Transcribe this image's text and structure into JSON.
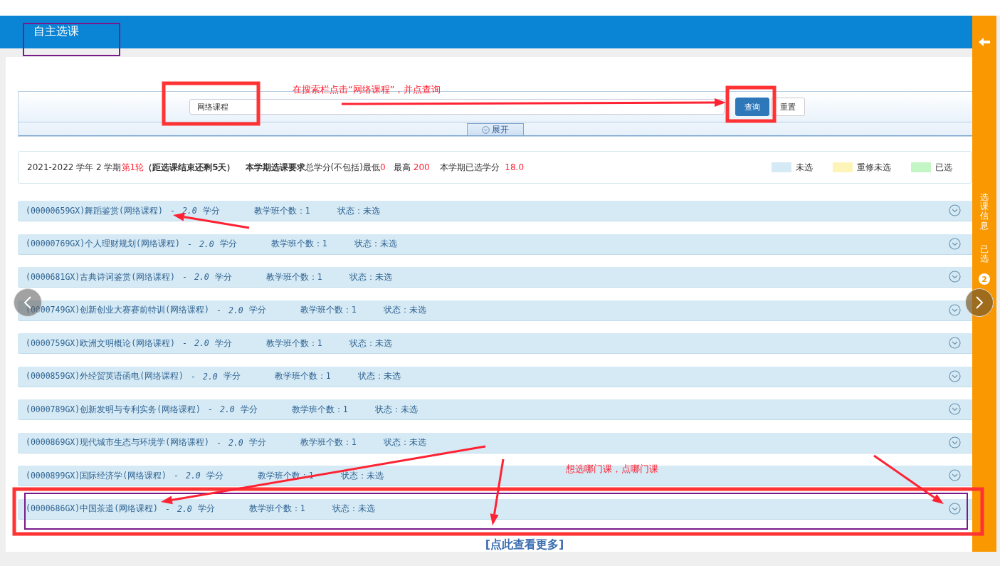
{
  "header": {
    "title": "自主选课"
  },
  "search": {
    "value": "网络课程",
    "buttons": [
      {
        "label": "查询",
        "kind": "primary"
      },
      {
        "label": "重置",
        "kind": "plain"
      }
    ],
    "expand": "展开"
  },
  "info": {
    "term": "2021-2022 学年 2 学期",
    "round": "第1轮",
    "remaining": "（距选课结束还剩5天）",
    "requirement_label": "本学期选课要求",
    "requirement_text": "总学分(不包括)最低",
    "min": "0",
    "max_label": "最高",
    "max": "200",
    "selected_label": "本学期已选学分",
    "selected": "18.0"
  },
  "legend": [
    {
      "label": "未选",
      "color": "#d6eaf5"
    },
    {
      "label": "重修未选",
      "color": "#fdf5b8"
    },
    {
      "label": "已选",
      "color": "#c4f5c4"
    }
  ],
  "courses": [
    {
      "title": "(00000659GX)舞蹈鉴赏(网络课程)",
      "dash": "-",
      "credit": "2.0",
      "unit": "学分",
      "classes": "教学班个数：1",
      "status": "状态：未选",
      "kind": "unselected"
    },
    {
      "title": "(00000769GX)个人理财规划(网络课程)",
      "dash": "-",
      "credit": "2.0",
      "unit": "学分",
      "classes": "教学班个数：1",
      "status": "状态：未选",
      "kind": "unselected"
    },
    {
      "title": "(0000681GX)古典诗词鉴赏(网络课程)",
      "dash": "-",
      "credit": "2.0",
      "unit": "学分",
      "classes": "教学班个数：1",
      "status": "状态：未选",
      "kind": "unselected"
    },
    {
      "title": "(0000749GX)创新创业大赛赛前特训(网络课程)",
      "dash": "-",
      "credit": "2.0",
      "unit": "学分",
      "classes": "教学班个数：1",
      "status": "状态：未选",
      "kind": "unselected"
    },
    {
      "title": "(0000759GX)欧洲文明概论(网络课程)",
      "dash": "-",
      "credit": "2.0",
      "unit": "学分",
      "classes": "教学班个数：1",
      "status": "状态：未选",
      "kind": "unselected"
    },
    {
      "title": "(0000859GX)外经贸英语函电(网络课程)",
      "dash": "-",
      "credit": "2.0",
      "unit": "学分",
      "classes": "教学班个数：1",
      "status": "状态：未选",
      "kind": "unselected"
    },
    {
      "title": "(0000789GX)创新发明与专利实务(网络课程)",
      "dash": "-",
      "credit": "2.0",
      "unit": "学分",
      "classes": "教学班个数：1",
      "status": "状态：未选",
      "kind": "unselected"
    },
    {
      "title": "(0000869GX)现代城市生态与环境学(网络课程)",
      "dash": "-",
      "credit": "2.0",
      "unit": "学分",
      "classes": "教学班个数：1",
      "status": "状态：未选",
      "kind": "unselected"
    },
    {
      "title": "(0000899GX)国际经济学(网络课程)",
      "dash": "-",
      "credit": "2.0",
      "unit": "学分",
      "classes": "教学班个数：1",
      "status": "状态：未选",
      "kind": "unselected"
    },
    {
      "title": "(0000686GX)中国茶道(网络课程)",
      "dash": "-",
      "credit": "2.0",
      "unit": "学分",
      "classes": "教学班个数：1",
      "status": "状态：未选",
      "kind": "unselected"
    }
  ],
  "more_link": "[点此查看更多]",
  "sidebar": {
    "tab_label": "选课信息",
    "selected_label": "已选",
    "selected_count": "2"
  },
  "annotations": [
    {
      "text": "在搜索栏点击“网络课程”，并点查询"
    },
    {
      "text": "想选哪门课，点哪门课"
    }
  ]
}
